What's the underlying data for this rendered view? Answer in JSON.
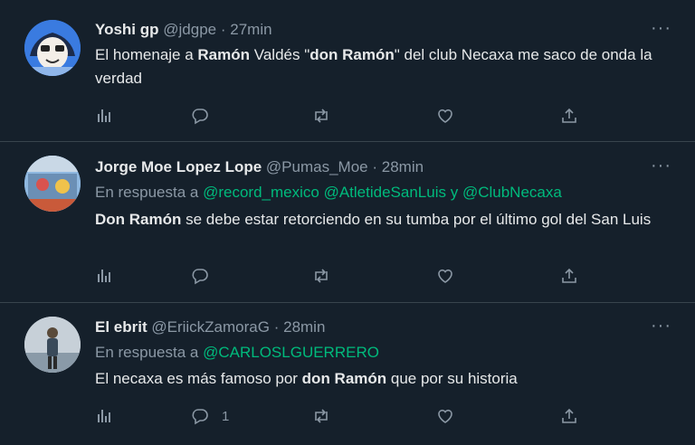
{
  "tweets": [
    {
      "name": "Yoshi gp",
      "handle": "@jdgpe",
      "sep": "·",
      "time": "27min",
      "reply_prefix": "",
      "mentions": [],
      "text": [
        {
          "t": "El homenaje a ",
          "b": false
        },
        {
          "t": "Ramón",
          "b": true
        },
        {
          "t": " Valdés \"",
          "b": false
        },
        {
          "t": "don Ramón",
          "b": true
        },
        {
          "t": "\" del club Necaxa me saco de onda la verdad",
          "b": false
        }
      ],
      "reply_count": "",
      "avatar_colors": [
        "#2a6fd6",
        "#cfe3f7"
      ]
    },
    {
      "name": "Jorge Moe Lopez Lope",
      "handle": "@Pumas_Moe",
      "sep": "·",
      "time": "28min",
      "reply_prefix": "En respuesta a",
      "mentions": [
        "@record_mexico",
        "@AtletideSanLuis",
        "y",
        "@ClubNecaxa"
      ],
      "text": [
        {
          "t": "Don Ramón",
          "b": true
        },
        {
          "t": " se debe estar retorciendo en su tumba por el último gol del San Luis",
          "b": false
        }
      ],
      "reply_count": "",
      "avatar_colors": [
        "#6fa2d6",
        "#c95a3a"
      ]
    },
    {
      "name": "El ebrit",
      "handle": "@EriickZamoraG",
      "sep": "·",
      "time": "28min",
      "reply_prefix": "En respuesta a",
      "mentions": [
        "@CARLOSLGUERRERO"
      ],
      "text": [
        {
          "t": "El necaxa es más famoso por ",
          "b": false
        },
        {
          "t": "don Ramón",
          "b": true
        },
        {
          "t": " que por su historia",
          "b": false
        }
      ],
      "reply_count": "1",
      "avatar_colors": [
        "#b9c3cc",
        "#3a4a5a"
      ]
    }
  ],
  "icons": {
    "more": "more-icon",
    "analytics": "analytics-icon",
    "reply": "reply-icon",
    "retweet": "retweet-icon",
    "like": "like-icon",
    "share": "share-icon"
  },
  "colors": {
    "background": "#15202b",
    "divider": "#38444d",
    "secondary_text": "#8b98a5",
    "mention": "#00ba7c"
  }
}
